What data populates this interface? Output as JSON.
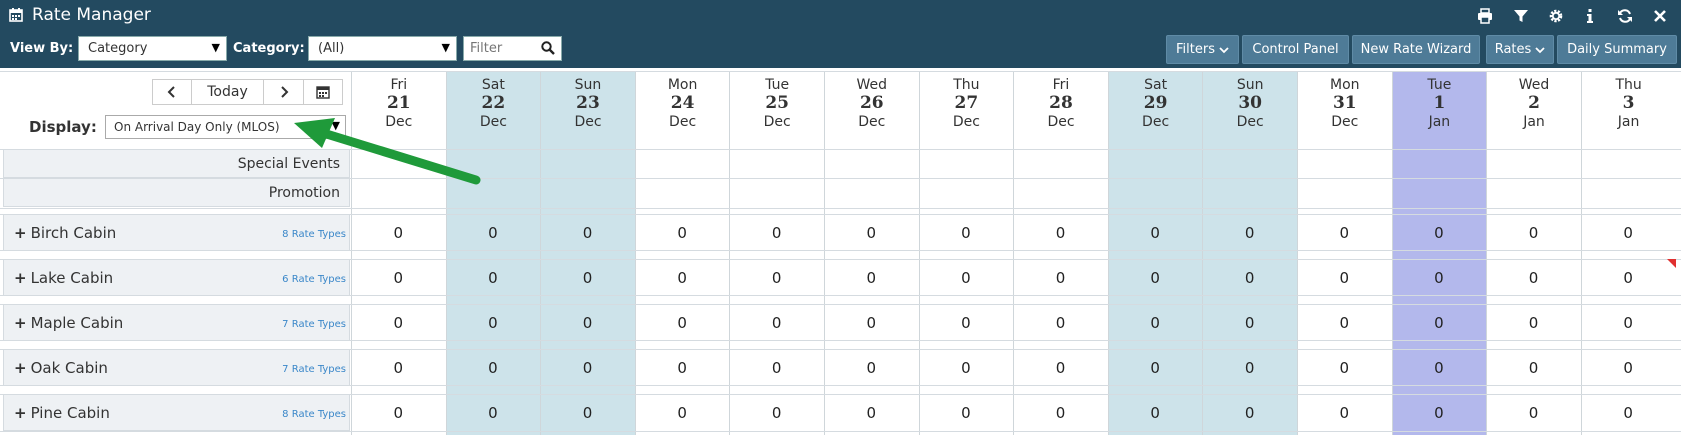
{
  "app": {
    "title": "Rate Manager",
    "icons": [
      "calendar-icon",
      "print-icon",
      "filter-icon",
      "settings-icon",
      "info-icon",
      "refresh-icon",
      "close-icon"
    ]
  },
  "toolbar": {
    "view_by_label": "View By:",
    "view_by_value": "Category",
    "category_label": "Category:",
    "category_value": "(All)",
    "filter_placeholder": "Filter",
    "buttons": {
      "filters": "Filters",
      "control_panel": "Control Panel",
      "new_rate_wizard": "New Rate Wizard",
      "rates": "Rates",
      "daily_summary": "Daily Summary"
    }
  },
  "nav": {
    "today_label": "Today",
    "display_label": "Display:",
    "display_value": "On Arrival Day Only (MLOS)"
  },
  "days": [
    {
      "dow": "Fri",
      "num": "21",
      "mon": "Dec",
      "type": "normal"
    },
    {
      "dow": "Sat",
      "num": "22",
      "mon": "Dec",
      "type": "weekend"
    },
    {
      "dow": "Sun",
      "num": "23",
      "mon": "Dec",
      "type": "weekend"
    },
    {
      "dow": "Mon",
      "num": "24",
      "mon": "Dec",
      "type": "normal"
    },
    {
      "dow": "Tue",
      "num": "25",
      "mon": "Dec",
      "type": "normal"
    },
    {
      "dow": "Wed",
      "num": "26",
      "mon": "Dec",
      "type": "normal"
    },
    {
      "dow": "Thu",
      "num": "27",
      "mon": "Dec",
      "type": "normal"
    },
    {
      "dow": "Fri",
      "num": "28",
      "mon": "Dec",
      "type": "normal"
    },
    {
      "dow": "Sat",
      "num": "29",
      "mon": "Dec",
      "type": "weekend"
    },
    {
      "dow": "Sun",
      "num": "30",
      "mon": "Dec",
      "type": "weekend"
    },
    {
      "dow": "Mon",
      "num": "31",
      "mon": "Dec",
      "type": "normal"
    },
    {
      "dow": "Tue",
      "num": "1",
      "mon": "Jan",
      "type": "today"
    },
    {
      "dow": "Wed",
      "num": "2",
      "mon": "Jan",
      "type": "normal"
    },
    {
      "dow": "Thu",
      "num": "3",
      "mon": "Jan",
      "type": "normal"
    }
  ],
  "info_rows": [
    {
      "label": "Special Events"
    },
    {
      "label": "Promotion"
    }
  ],
  "rooms": [
    {
      "name": "Birch Cabin",
      "rate_types": "8 Rate Types",
      "values": [
        "0",
        "0",
        "0",
        "0",
        "0",
        "0",
        "0",
        "0",
        "0",
        "0",
        "0",
        "0",
        "0",
        "0"
      ]
    },
    {
      "name": "Lake Cabin",
      "rate_types": "6 Rate Types",
      "values": [
        "0",
        "0",
        "0",
        "0",
        "0",
        "0",
        "0",
        "0",
        "0",
        "0",
        "0",
        "0",
        "0",
        "0"
      ]
    },
    {
      "name": "Maple Cabin",
      "rate_types": "7 Rate Types",
      "values": [
        "0",
        "0",
        "0",
        "0",
        "0",
        "0",
        "0",
        "0",
        "0",
        "0",
        "0",
        "0",
        "0",
        "0"
      ]
    },
    {
      "name": "Oak Cabin",
      "rate_types": "7 Rate Types",
      "values": [
        "0",
        "0",
        "0",
        "0",
        "0",
        "0",
        "0",
        "0",
        "0",
        "0",
        "0",
        "0",
        "0",
        "0"
      ]
    },
    {
      "name": "Pine Cabin",
      "rate_types": "8 Rate Types",
      "values": [
        "0",
        "0",
        "0",
        "0",
        "0",
        "0",
        "0",
        "0",
        "0",
        "0",
        "0",
        "0",
        "0",
        "0"
      ]
    }
  ],
  "colors": {
    "header_bg": "#234a60",
    "button_bg": "#4e7b97",
    "weekend_bg": "#cde3ea",
    "today_bg": "#b3b8ec",
    "annotation_arrow": "#1f9a3a",
    "link": "#3a87c9"
  }
}
